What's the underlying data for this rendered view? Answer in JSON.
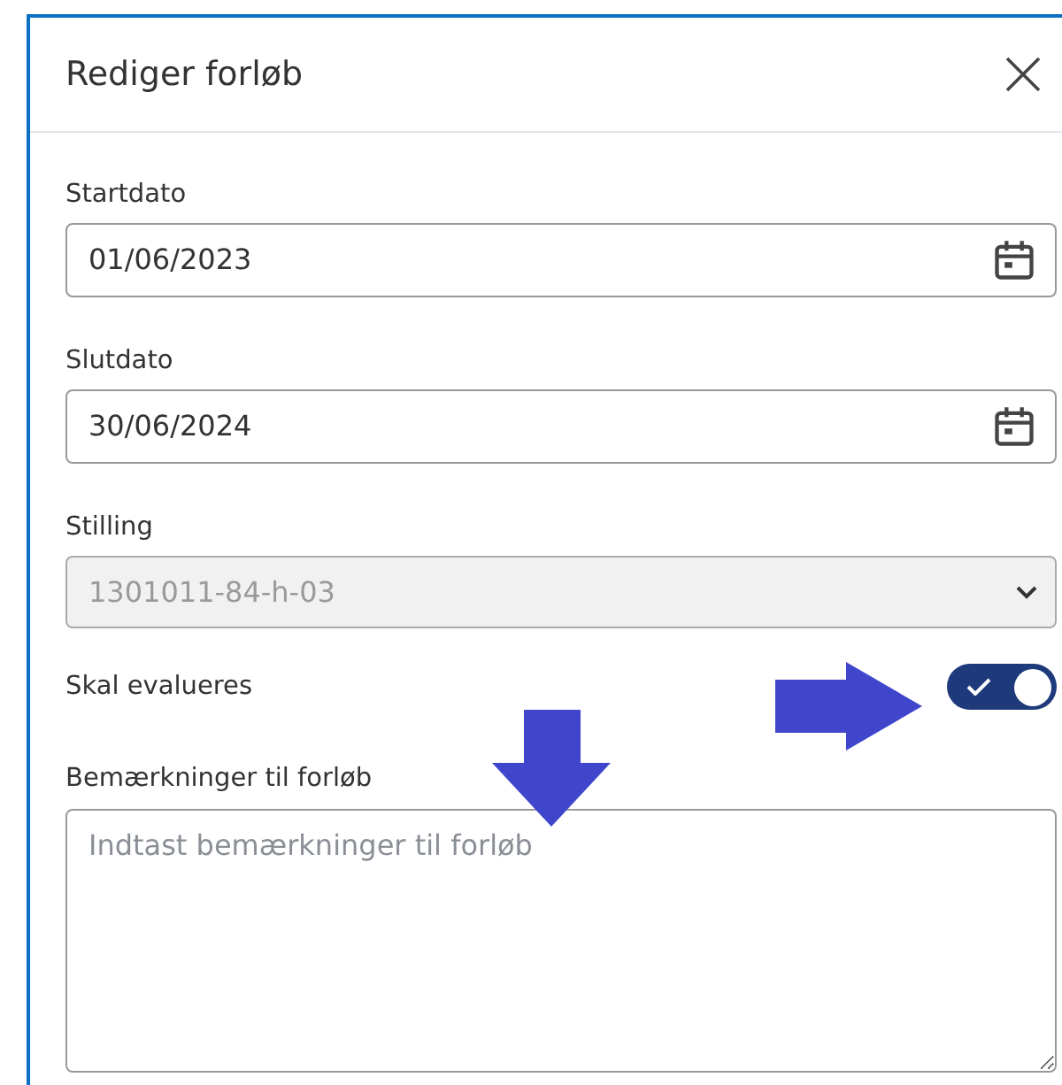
{
  "dialog": {
    "title": "Rediger forløb"
  },
  "fields": [
    {
      "kind": "date",
      "label": "Startdato",
      "value": "01/06/2023"
    },
    {
      "kind": "date",
      "label": "Slutdato",
      "value": "30/06/2024"
    },
    {
      "kind": "select",
      "label": "Stilling",
      "value": "1301011-84-h-03",
      "disabled": true
    },
    {
      "kind": "toggle",
      "label": "Skal evalueres",
      "on": true
    },
    {
      "kind": "textarea",
      "label": "Bemærkninger til forløb",
      "placeholder": "Indtast bemærkninger til forløb"
    }
  ]
}
